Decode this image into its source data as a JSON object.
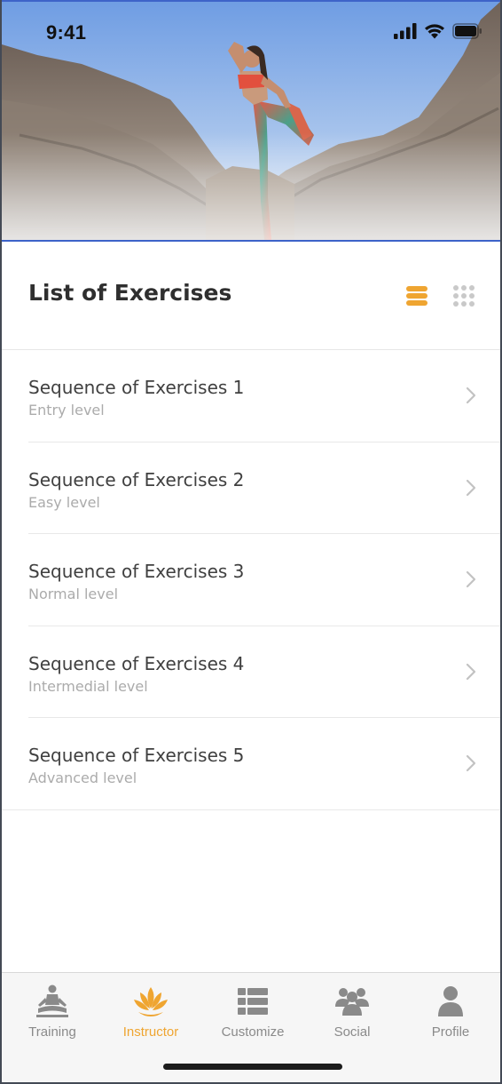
{
  "status_bar": {
    "time": "9:41"
  },
  "colors": {
    "accent": "#efa531",
    "inactive": "#8a8a8a",
    "title": "#2f2f2f",
    "subtitle": "#ababab"
  },
  "header": {
    "title": "List of Exercises",
    "view_mode": "list"
  },
  "exercises": [
    {
      "name": "Sequence of Exercises 1",
      "level": "Entry level"
    },
    {
      "name": "Sequence of Exercises 2",
      "level": "Easy level"
    },
    {
      "name": "Sequence of Exercises 3",
      "level": "Normal level"
    },
    {
      "name": "Sequence of Exercises 4",
      "level": "Intermedial level"
    },
    {
      "name": "Sequence of Exercises 5",
      "level": "Advanced level"
    }
  ],
  "tabbar": {
    "active": "Instructor",
    "tabs": [
      {
        "label": "Training",
        "icon": "meditation-icon"
      },
      {
        "label": "Instructor",
        "icon": "lotus-icon"
      },
      {
        "label": "Customize",
        "icon": "list-icon"
      },
      {
        "label": "Social",
        "icon": "group-icon"
      },
      {
        "label": "Profile",
        "icon": "user-icon"
      }
    ]
  }
}
